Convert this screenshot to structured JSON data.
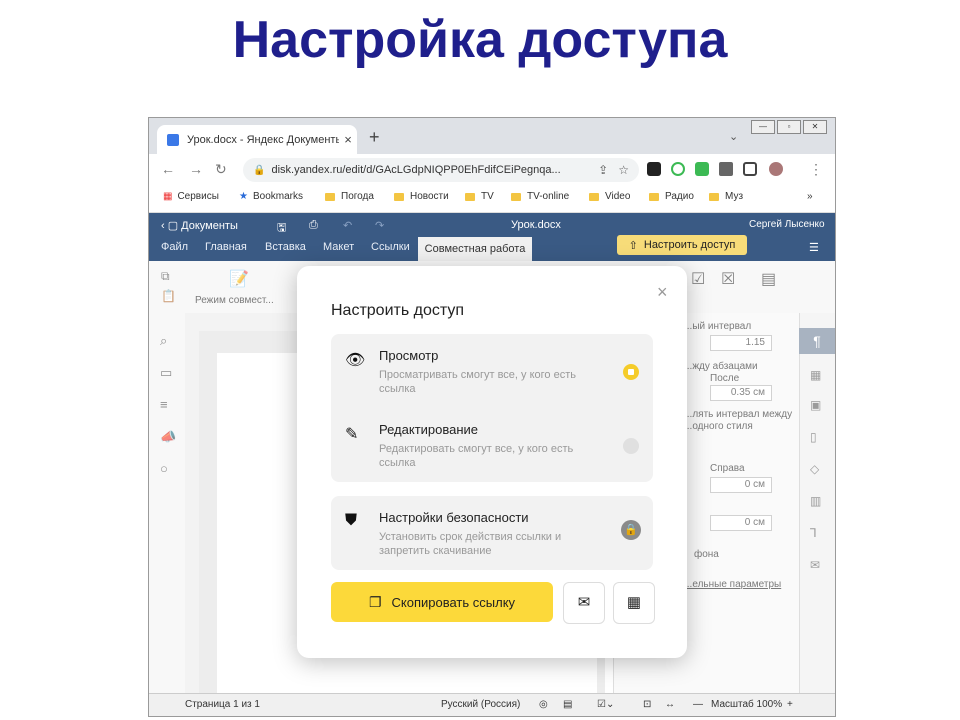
{
  "slide": {
    "title": "Настройка доступа"
  },
  "browser": {
    "tab_title": "Урок.docx - Яндекс Документы",
    "tab_close": "×",
    "new_tab": "+",
    "url": "disk.yandex.ru/edit/d/GAcLGdpNIQPP0EhFdifCEiPegnqa...",
    "bookmarks": [
      "Сервисы",
      "Bookmarks",
      "Погода",
      "Новости",
      "TV",
      "TV-online",
      "Video",
      "Радио",
      "Муз"
    ],
    "bookmarks_more": "»"
  },
  "app": {
    "brand": "Документы",
    "doc_name": "Урок.docx",
    "user": "Сергей Лысенко",
    "menu": [
      "Файл",
      "Главная",
      "Вставка",
      "Макет",
      "Ссылки"
    ],
    "menu_active": "Совместная работа",
    "share_button": "Настроить доступ",
    "review_mode": "Режим совмест..."
  },
  "right_panel": {
    "line_spacing_label": "...ый интервал",
    "line_spacing_value": "1.15",
    "paragraph_spacing_label": "...жду абзацами",
    "after_label": "После",
    "after_value": "0.35 см",
    "interval_note_1": "...лять интервал между",
    "interval_note_2": "...одного стиля",
    "right_label": "Справа",
    "right_value": "0 см",
    "value_2": "0 см",
    "background_label": "фона",
    "advanced_link": "...ельные параметры"
  },
  "status": {
    "page": "Страница 1 из 1",
    "language": "Русский (Россия)",
    "zoom": "Масштаб 100%"
  },
  "modal": {
    "title": "Настроить доступ",
    "close": "×",
    "options": [
      {
        "title": "Просмотр",
        "desc": "Просматривать смогут все, у кого есть ссылка"
      },
      {
        "title": "Редактирование",
        "desc": "Редактировать смогут все, у кого есть ссылка"
      }
    ],
    "security": {
      "title": "Настройки безопасности",
      "desc": "Установить срок действия ссылки и запретить скачивание"
    },
    "copy_button": "Скопировать ссылку"
  }
}
